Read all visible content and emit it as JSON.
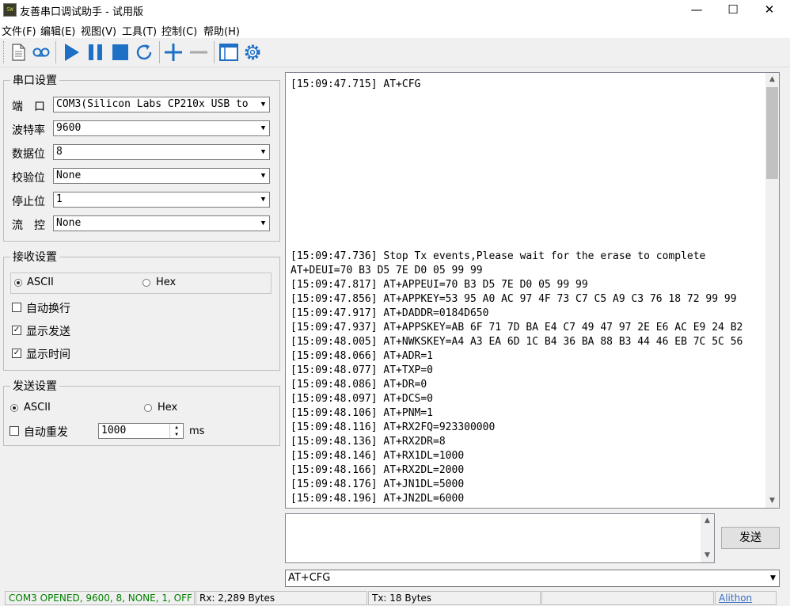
{
  "window": {
    "title": "友善串口调试助手 - 试用版",
    "app_icon_text": "SW",
    "minimize": "—",
    "maximize": "☐",
    "close": "✕"
  },
  "menu": [
    "文件(F)",
    "编辑(E)",
    "视图(V)",
    "工具(T)",
    "控制(C)",
    "帮助(H)"
  ],
  "toolbar": {
    "icons": [
      "new-document-icon",
      "record-icon",
      "play-icon",
      "pause-icon",
      "stop-icon",
      "refresh-icon",
      "add-icon",
      "remove-icon",
      "window-icon",
      "gear-icon"
    ],
    "accent_color": "#1e6fc6"
  },
  "serial_settings": {
    "title": "串口设置",
    "fields": [
      {
        "label": "端　口",
        "value": "COM3(Silicon Labs CP210x USB to"
      },
      {
        "label": "波特率",
        "value": "9600"
      },
      {
        "label": "数据位",
        "value": "8"
      },
      {
        "label": "校验位",
        "value": "None"
      },
      {
        "label": "停止位",
        "value": "1"
      },
      {
        "label": "流　控",
        "value": "None"
      }
    ]
  },
  "receive_settings": {
    "title": "接收设置",
    "ascii": "ASCII",
    "hex": "Hex",
    "auto_wrap": "自动换行",
    "show_send": "显示发送",
    "show_time": "显示时间"
  },
  "send_settings": {
    "title": "发送设置",
    "ascii": "ASCII",
    "hex": "Hex",
    "auto_resend": "自动重发",
    "interval": "1000",
    "unit": "ms"
  },
  "receive_log": {
    "first": "[15:09:47.715] AT+CFG",
    "lines": [
      "[15:09:47.736] Stop Tx events,Please wait for the erase to complete",
      "AT+DEUI=70 B3 D5 7E D0 05 99 99",
      "[15:09:47.817] AT+APPEUI=70 B3 D5 7E D0 05 99 99",
      "[15:09:47.856] AT+APPKEY=53 95 A0 AC 97 4F 73 C7 C5 A9 C3 76 18 72 99 99",
      "[15:09:47.917] AT+DADDR=0184D650",
      "[15:09:47.937] AT+APPSKEY=AB 6F 71 7D BA E4 C7 49 47 97 2E E6 AC E9 24 B2",
      "[15:09:48.005] AT+NWKSKEY=A4 A3 EA 6D 1C B4 36 BA 88 B3 44 46 EB 7C 5C 56",
      "[15:09:48.066] AT+ADR=1",
      "[15:09:48.077] AT+TXP=0",
      "[15:09:48.086] AT+DR=0",
      "[15:09:48.097] AT+DCS=0",
      "[15:09:48.106] AT+PNM=1",
      "[15:09:48.116] AT+RX2FQ=923300000",
      "[15:09:48.136] AT+RX2DR=8",
      "[15:09:48.146] AT+RX1DL=1000",
      "[15:09:48.166] AT+RX2DL=2000",
      "[15:09:48.176] AT+JN1DL=5000",
      "[15:09:48.196] AT+JN2DL=6000"
    ]
  },
  "send": {
    "button": "发送",
    "command": "AT+CFG"
  },
  "status_bar": {
    "connection": "COM3 OPENED, 9600, 8, NONE, 1, OFF",
    "connection_color": "#008000",
    "rx": "Rx: 2,289 Bytes",
    "tx": "Tx: 18 Bytes",
    "brand": "Alithon"
  }
}
